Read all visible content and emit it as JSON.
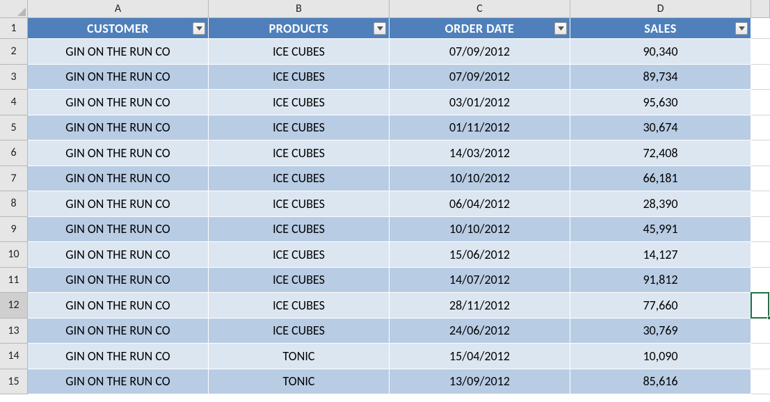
{
  "columns": [
    "A",
    "B",
    "C",
    "D"
  ],
  "headers": {
    "customer": "CUSTOMER",
    "products": "PRODUCTS",
    "order_date": "ORDER DATE",
    "sales": "SALES"
  },
  "row_numbers": [
    1,
    2,
    3,
    4,
    5,
    6,
    7,
    8,
    9,
    10,
    11,
    12,
    13,
    14,
    15
  ],
  "selected_row": 12,
  "rows": [
    {
      "customer": "GIN ON THE RUN CO",
      "products": "ICE CUBES",
      "order_date": "07/09/2012",
      "sales": "90,340"
    },
    {
      "customer": "GIN ON THE RUN CO",
      "products": "ICE CUBES",
      "order_date": "07/09/2012",
      "sales": "89,734"
    },
    {
      "customer": "GIN ON THE RUN CO",
      "products": "ICE CUBES",
      "order_date": "03/01/2012",
      "sales": "95,630"
    },
    {
      "customer": "GIN ON THE RUN CO",
      "products": "ICE CUBES",
      "order_date": "01/11/2012",
      "sales": "30,674"
    },
    {
      "customer": "GIN ON THE RUN CO",
      "products": "ICE CUBES",
      "order_date": "14/03/2012",
      "sales": "72,408"
    },
    {
      "customer": "GIN ON THE RUN CO",
      "products": "ICE CUBES",
      "order_date": "10/10/2012",
      "sales": "66,181"
    },
    {
      "customer": "GIN ON THE RUN CO",
      "products": "ICE CUBES",
      "order_date": "06/04/2012",
      "sales": "28,390"
    },
    {
      "customer": "GIN ON THE RUN CO",
      "products": "ICE CUBES",
      "order_date": "10/10/2012",
      "sales": "45,991"
    },
    {
      "customer": "GIN ON THE RUN CO",
      "products": "ICE CUBES",
      "order_date": "15/06/2012",
      "sales": "14,127"
    },
    {
      "customer": "GIN ON THE RUN CO",
      "products": "ICE CUBES",
      "order_date": "14/07/2012",
      "sales": "91,812"
    },
    {
      "customer": "GIN ON THE RUN CO",
      "products": "ICE CUBES",
      "order_date": "28/11/2012",
      "sales": "77,660"
    },
    {
      "customer": "GIN ON THE RUN CO",
      "products": "ICE CUBES",
      "order_date": "24/06/2012",
      "sales": "30,769"
    },
    {
      "customer": "GIN ON THE RUN CO",
      "products": "TONIC",
      "order_date": "15/04/2012",
      "sales": "10,090"
    },
    {
      "customer": "GIN ON THE RUN CO",
      "products": "TONIC",
      "order_date": "13/09/2012",
      "sales": "85,616"
    }
  ]
}
